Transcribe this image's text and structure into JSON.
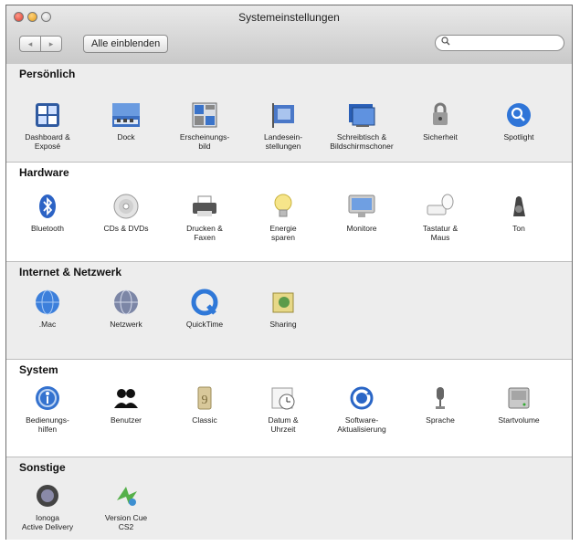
{
  "window": {
    "title": "Systemeinstellungen"
  },
  "toolbar": {
    "back_label": "◂",
    "forward_label": "▸",
    "show_all_label": "Alle einblenden",
    "search_value": "",
    "search_placeholder": ""
  },
  "sections": {
    "personal": {
      "title": "Persönlich",
      "items": [
        {
          "label": "Dashboard &\nExposé",
          "icon": "dashboard-icon"
        },
        {
          "label": "Dock",
          "icon": "dock-icon"
        },
        {
          "label": "Erscheinungs-\nbild",
          "icon": "appearance-icon"
        },
        {
          "label": "Landesein-\nstellungen",
          "icon": "flag-icon"
        },
        {
          "label": "Schreibtisch &\nBildschirmschoner",
          "icon": "desktop-icon"
        },
        {
          "label": "Sicherheit",
          "icon": "lock-icon"
        },
        {
          "label": "Spotlight",
          "icon": "spotlight-icon"
        }
      ]
    },
    "hardware": {
      "title": "Hardware",
      "items": [
        {
          "label": "Bluetooth",
          "icon": "bluetooth-icon"
        },
        {
          "label": "CDs & DVDs",
          "icon": "cd-icon"
        },
        {
          "label": "Drucken &\nFaxen",
          "icon": "printer-icon"
        },
        {
          "label": "Energie\nsparen",
          "icon": "bulb-icon"
        },
        {
          "label": "Monitore",
          "icon": "monitor-icon"
        },
        {
          "label": "Tastatur &\nMaus",
          "icon": "keyboard-mouse-icon"
        },
        {
          "label": "Ton",
          "icon": "speaker-icon"
        }
      ]
    },
    "internet": {
      "title": "Internet & Netzwerk",
      "items": [
        {
          "label": ".Mac",
          "icon": "mac-globe-icon"
        },
        {
          "label": "Netzwerk",
          "icon": "network-icon"
        },
        {
          "label": "QuickTime",
          "icon": "quicktime-icon"
        },
        {
          "label": "Sharing",
          "icon": "sharing-icon"
        }
      ]
    },
    "system": {
      "title": "System",
      "items": [
        {
          "label": "Bedienungs-\nhilfen",
          "icon": "accessibility-icon"
        },
        {
          "label": "Benutzer",
          "icon": "users-icon"
        },
        {
          "label": "Classic",
          "icon": "classic-icon"
        },
        {
          "label": "Datum &\nUhrzeit",
          "icon": "clock-icon"
        },
        {
          "label": "Software-\nAktualisierung",
          "icon": "update-icon"
        },
        {
          "label": "Sprache",
          "icon": "microphone-icon"
        },
        {
          "label": "Startvolume",
          "icon": "disk-icon"
        }
      ]
    },
    "other": {
      "title": "Sonstige",
      "items": [
        {
          "label": "Ionoga\nActive Delivery",
          "icon": "ionoga-icon"
        },
        {
          "label": "Version Cue\nCS2",
          "icon": "version-cue-icon"
        }
      ]
    }
  }
}
